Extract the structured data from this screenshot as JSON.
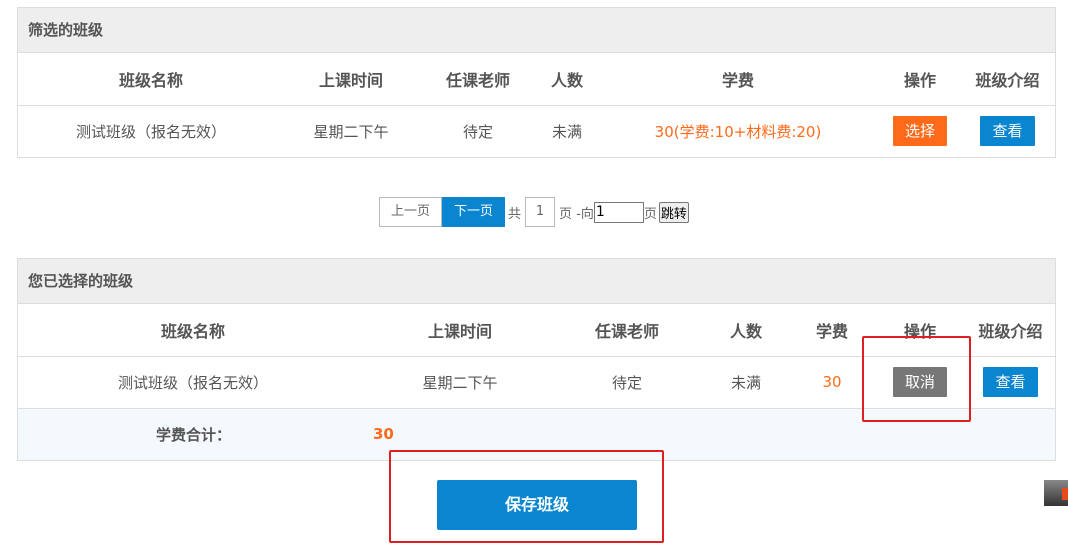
{
  "filtered": {
    "title": "筛选的班级",
    "headers": [
      "班级名称",
      "上课时间",
      "任课老师",
      "人数",
      "学费",
      "操作",
      "班级介绍"
    ],
    "rows": [
      {
        "name": "测试班级（报名无效）",
        "time": "星期二下午",
        "teacher": "待定",
        "count": "未满",
        "fee": "30(学费:10+材料费:20)",
        "action": "选择",
        "intro": "查看"
      }
    ]
  },
  "pager": {
    "prev": "上一页",
    "next": "下一页",
    "total_prefix": "共",
    "total_pages": "1",
    "page_suffix": "页 -向",
    "goto_value": "1",
    "page_unit": "页",
    "goto": "跳转"
  },
  "selected": {
    "title": "您已选择的班级",
    "headers": [
      "班级名称",
      "上课时间",
      "任课老师",
      "人数",
      "学费",
      "操作",
      "班级介绍"
    ],
    "rows": [
      {
        "name": "测试班级（报名无效）",
        "time": "星期二下午",
        "teacher": "待定",
        "count": "未满",
        "fee": "30",
        "action": "取消",
        "intro": "查看"
      }
    ],
    "total_label": "学费合计：",
    "total_value": "30"
  },
  "save_label": "保存班级",
  "colors": {
    "accent": "#0a85d0",
    "orange": "#ff6a1a",
    "highlight": "#e02020"
  }
}
